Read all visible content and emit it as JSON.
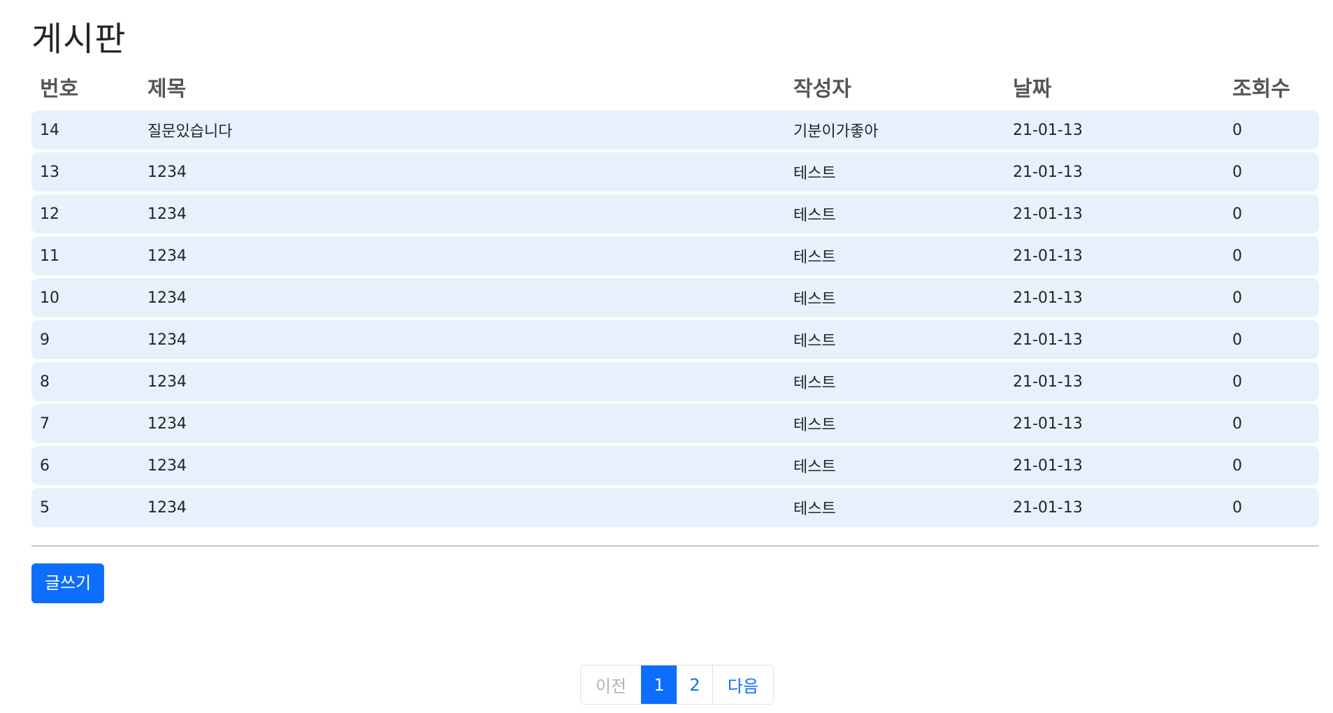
{
  "page": {
    "title": "게시판"
  },
  "table": {
    "headers": {
      "no": "번호",
      "title": "제목",
      "writer": "작성자",
      "date": "날짜",
      "views": "조회수"
    },
    "rows": [
      {
        "no": "14",
        "title": "질문있습니다",
        "writer": "기분이가좋아",
        "date": "21-01-13",
        "views": "0"
      },
      {
        "no": "13",
        "title": "1234",
        "writer": "테스트",
        "date": "21-01-13",
        "views": "0"
      },
      {
        "no": "12",
        "title": "1234",
        "writer": "테스트",
        "date": "21-01-13",
        "views": "0"
      },
      {
        "no": "11",
        "title": "1234",
        "writer": "테스트",
        "date": "21-01-13",
        "views": "0"
      },
      {
        "no": "10",
        "title": "1234",
        "writer": "테스트",
        "date": "21-01-13",
        "views": "0"
      },
      {
        "no": "9",
        "title": "1234",
        "writer": "테스트",
        "date": "21-01-13",
        "views": "0"
      },
      {
        "no": "8",
        "title": "1234",
        "writer": "테스트",
        "date": "21-01-13",
        "views": "0"
      },
      {
        "no": "7",
        "title": "1234",
        "writer": "테스트",
        "date": "21-01-13",
        "views": "0"
      },
      {
        "no": "6",
        "title": "1234",
        "writer": "테스트",
        "date": "21-01-13",
        "views": "0"
      },
      {
        "no": "5",
        "title": "1234",
        "writer": "테스트",
        "date": "21-01-13",
        "views": "0"
      }
    ]
  },
  "actions": {
    "write_label": "글쓰기"
  },
  "pagination": {
    "prev_label": "이전",
    "pages": [
      "1",
      "2"
    ],
    "active_page": "1",
    "next_label": "다음"
  },
  "colors": {
    "primary": "#0d6efd",
    "row_background": "#e8f1fb",
    "header_text": "#555555",
    "disabled_text": "#b0b4b8"
  }
}
